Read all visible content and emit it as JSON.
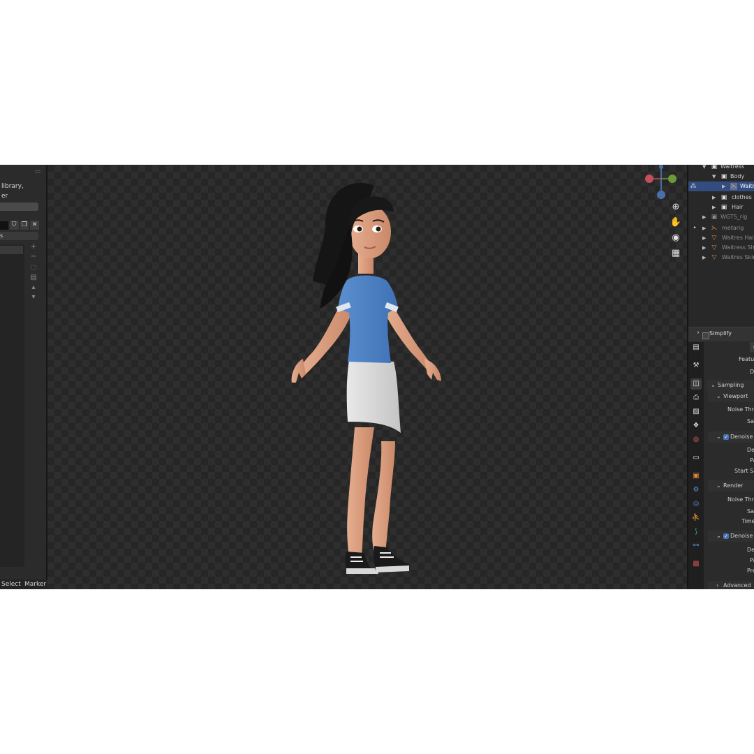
{
  "left_panel": {
    "text_library": "library,",
    "text_er": "er",
    "text_s": "s",
    "icons": [
      "shield-icon",
      "copy-icon",
      "close-icon"
    ],
    "side_buttons": [
      "+",
      "−",
      "◌",
      "▤",
      "▴",
      "▾"
    ],
    "timeline": {
      "select": "Select",
      "marker": "Marker"
    }
  },
  "viewport": {
    "gizmo_axes": [
      "red-x-axis",
      "green-y-axis",
      "blue-z-axis"
    ],
    "tools": [
      "zoom-icon",
      "hand-pan-icon",
      "camera-icon",
      "grid-icon"
    ]
  },
  "outliner": {
    "rows": [
      {
        "label": "Waitress",
        "icon": "collection-icon",
        "dim": false
      },
      {
        "label": "Body",
        "icon": "collection-icon",
        "dim": false
      },
      {
        "label": "Waitr",
        "icon": "armature-icon",
        "dim": false,
        "selected": true
      },
      {
        "label": "clothes",
        "icon": "collection-icon",
        "dim": false
      },
      {
        "label": "Hair",
        "icon": "collection-icon",
        "dim": false
      },
      {
        "label": "WGTS_rig",
        "icon": "collection-icon",
        "dim": true
      },
      {
        "label": "metarig",
        "icon": "armature-icon",
        "dim": true
      },
      {
        "label": "Waitres Hair",
        "icon": "mesh-icon",
        "dim": true
      },
      {
        "label": "Waitress Shoe",
        "icon": "mesh-icon",
        "dim": true
      },
      {
        "label": "Waitres Skirt",
        "icon": "mesh-icon",
        "dim": true
      }
    ]
  },
  "properties": {
    "simplify": "Simplify",
    "feature": "Feature",
    "de": "De",
    "sampling": "Sampling",
    "viewport": "Viewport",
    "noise_thre_1": "Noise Thre",
    "sar_1": "Sar",
    "denoise_1": "Denoise",
    "den_1": "Den",
    "pa_1": "Pa",
    "start_sa": "Start Sa",
    "render": "Render",
    "noise_thre_2": "Noise Thre",
    "sar_2": "Sar",
    "time": "Time",
    "denoise_2": "Denoise",
    "den_2": "Den",
    "pa_2": "Pa",
    "pre": "Pre",
    "advanced": "Advanced",
    "tabs": [
      "tool-icon",
      "render-icon",
      "output-icon",
      "view-layer-icon",
      "scene-icon",
      "world-icon",
      "collection-icon",
      "object-icon",
      "modifier-icon",
      "particles-icon",
      "physics-icon",
      "constraints-icon",
      "data-icon",
      "material-icon"
    ]
  }
}
